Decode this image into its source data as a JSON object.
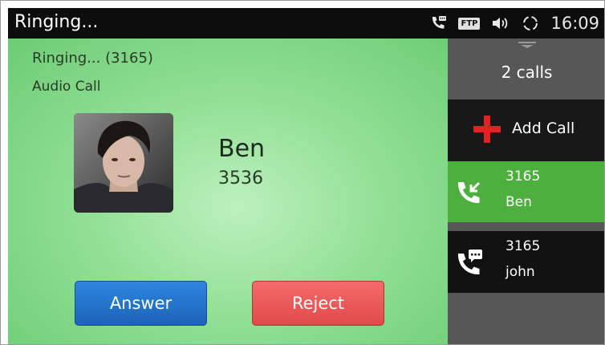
{
  "status_bar": {
    "title": "Ringing...",
    "ftp_badge": "FTP",
    "time": "16:09"
  },
  "call": {
    "status_line": "Ringing... (3165)",
    "call_type": "Audio Call",
    "contact_name": "Ben",
    "contact_number": "3536",
    "answer_label": "Answer",
    "reject_label": "Reject"
  },
  "side_panel": {
    "calls_count": "2 calls",
    "add_call_label": "Add Call",
    "calls": [
      {
        "number": "3165",
        "name": "Ben",
        "state": "incoming",
        "active": true
      },
      {
        "number": "3165",
        "name": "john",
        "state": "on-hold",
        "active": false
      }
    ]
  },
  "colors": {
    "status_bar": "#0d0d0d",
    "call_bg": "#92e096",
    "answer": "#2176cf",
    "reject": "#ea5a5a",
    "side_panel": "#575757",
    "active_call": "#4caf3e",
    "add_call_plus": "#e02222"
  },
  "icons": {
    "status": [
      "phone-message-icon",
      "ftp-icon",
      "volume-icon",
      "sync-icon"
    ],
    "side": [
      "drag-handle-icon",
      "plus-icon",
      "incoming-call-icon",
      "call-hold-message-icon"
    ]
  }
}
